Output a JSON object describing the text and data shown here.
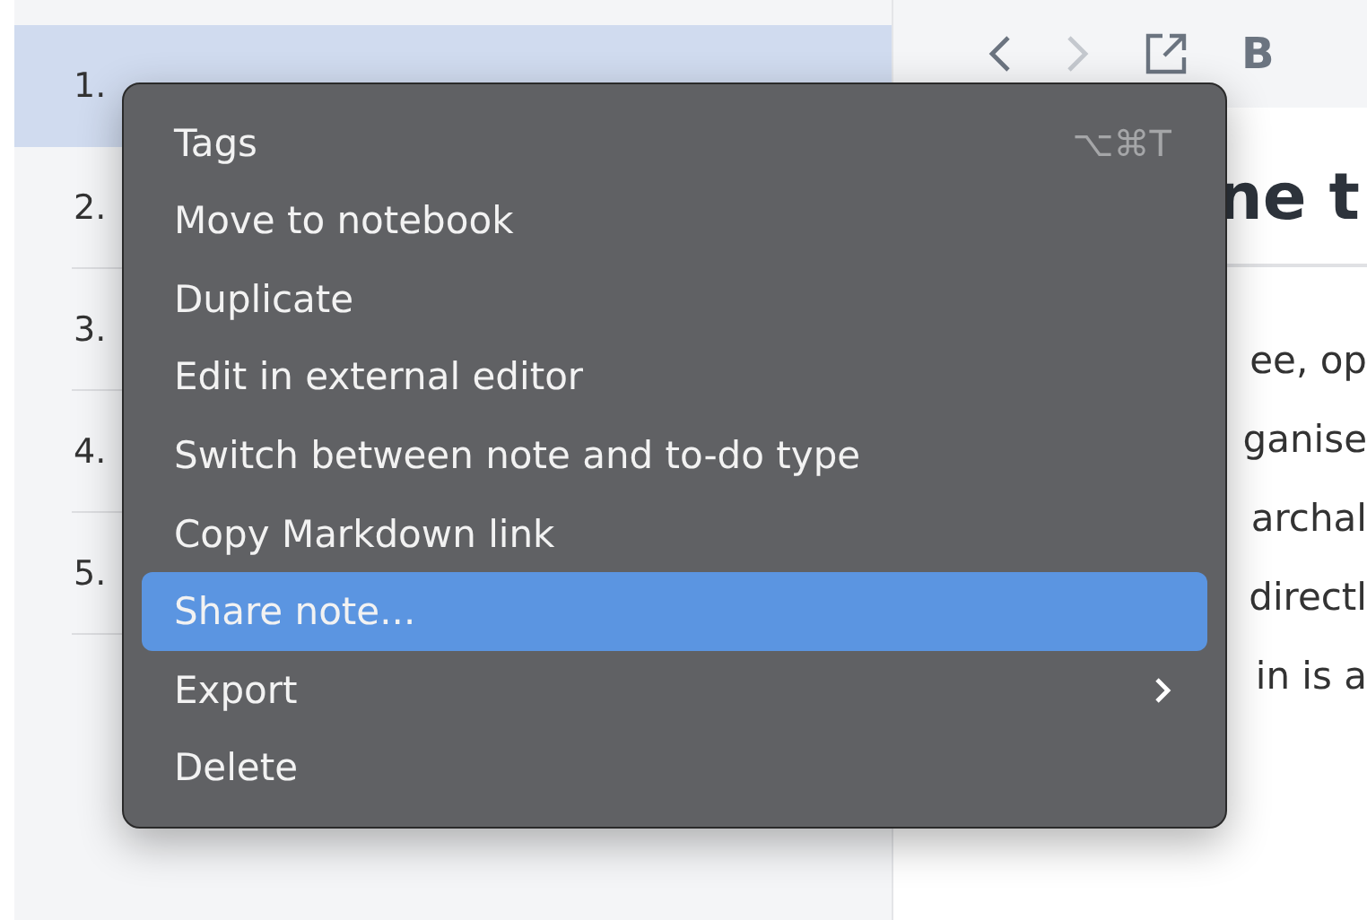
{
  "note_list": {
    "items": [
      {
        "number": "1.",
        "selected": true
      },
      {
        "number": "2.",
        "selected": false
      },
      {
        "number": "3.",
        "selected": false
      },
      {
        "number": "4.",
        "selected": false
      },
      {
        "number": "5.",
        "selected": false
      }
    ]
  },
  "editor": {
    "toolbar": {
      "bold_label": "B"
    },
    "heading": "ne t",
    "lines": [
      "ee, op",
      "ganise",
      "archal",
      "directl",
      "in is a"
    ]
  },
  "context_menu": {
    "items": [
      {
        "label": "Tags",
        "shortcut": "⌥⌘T",
        "kind": "plain",
        "selected": false
      },
      {
        "label": "Move to notebook",
        "kind": "plain",
        "selected": false
      },
      {
        "label": "Duplicate",
        "kind": "plain",
        "selected": false
      },
      {
        "label": "Edit in external editor",
        "kind": "plain",
        "selected": false
      },
      {
        "label": "Switch between note and to-do type",
        "kind": "plain",
        "selected": false
      },
      {
        "label": "Copy Markdown link",
        "kind": "plain",
        "selected": false
      },
      {
        "label": "Share note...",
        "kind": "plain",
        "selected": true
      },
      {
        "label": "Export",
        "kind": "submenu",
        "selected": false
      },
      {
        "label": "Delete",
        "kind": "plain",
        "selected": false
      }
    ]
  }
}
